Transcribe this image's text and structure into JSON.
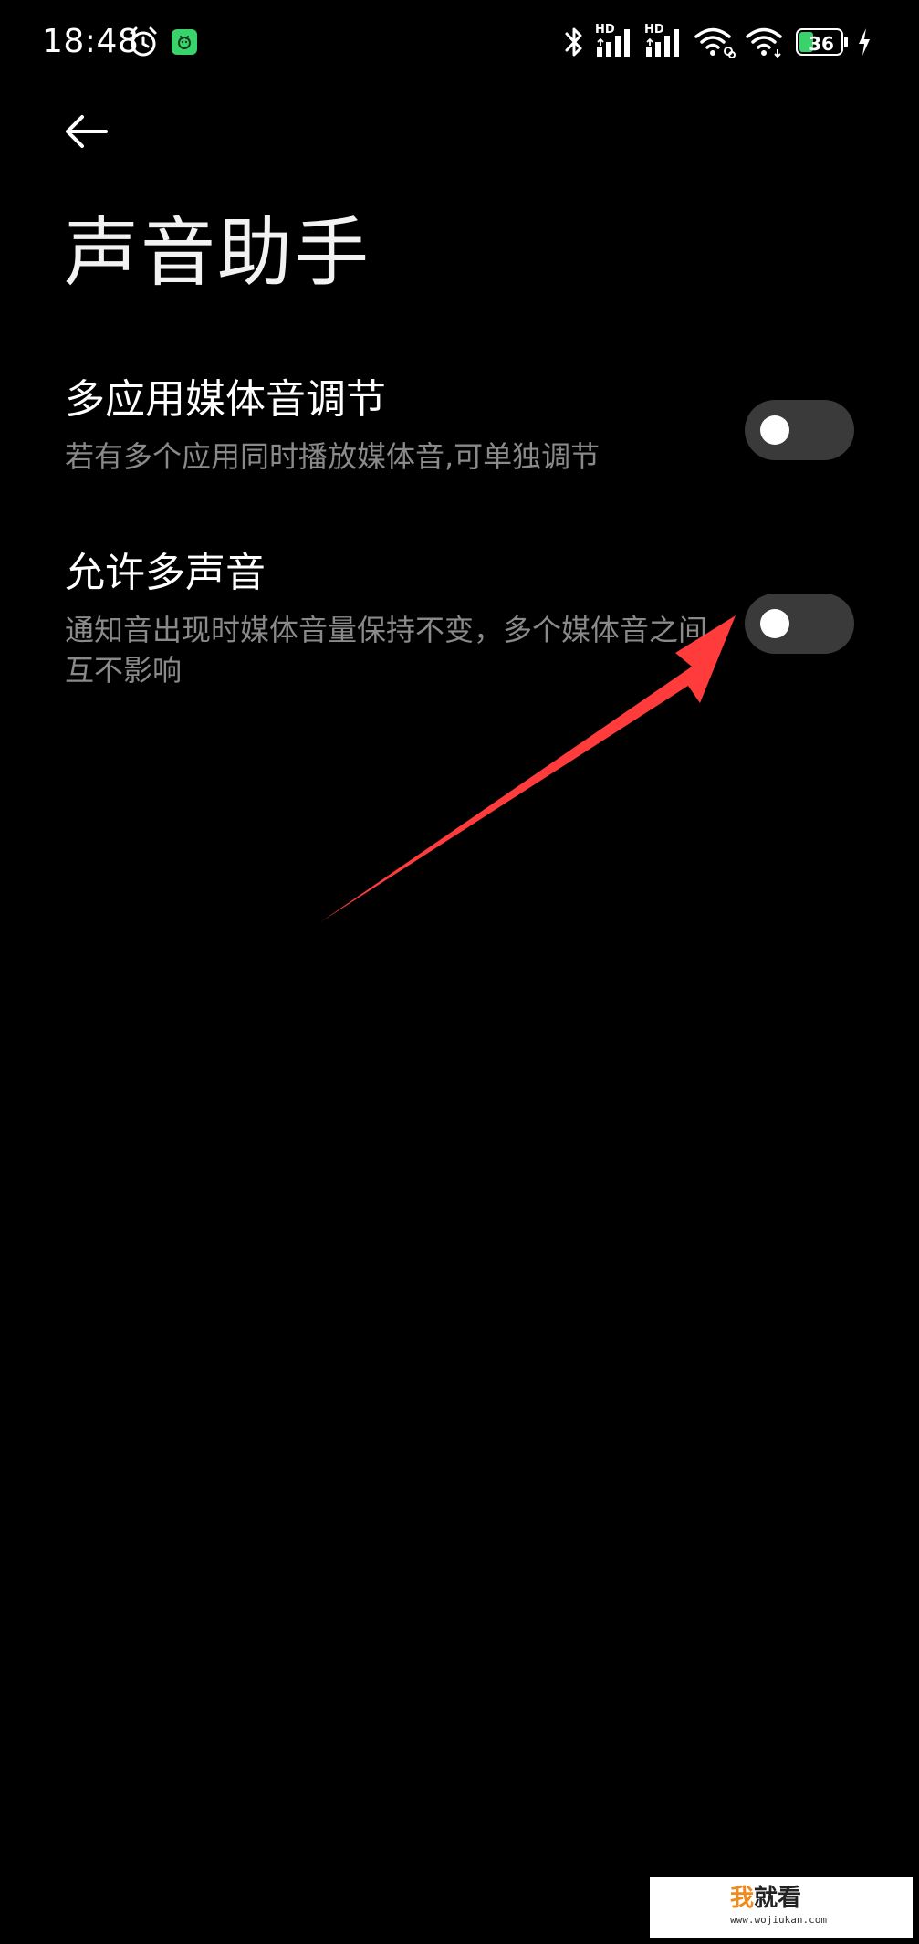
{
  "status_bar": {
    "time": "18:48",
    "battery_level": "36",
    "battery_fraction": 0.36,
    "network_label_1": "HD",
    "network_label_2": "HD",
    "icons": [
      "alarm-icon",
      "app-notification-icon",
      "bluetooth-icon",
      "signal-icon",
      "signal-icon",
      "wifi-icon",
      "wifi-icon",
      "battery-icon",
      "charging-icon"
    ]
  },
  "header": {
    "back_icon": "arrow-left-icon",
    "title": "声音助手"
  },
  "settings": [
    {
      "title": "多应用媒体音调节",
      "description": "若有多个应用同时播放媒体音,可单独调节",
      "enabled": false
    },
    {
      "title": "允许多声音",
      "description": "通知音出现时媒体音量保持不变，多个媒体音之间互不影响",
      "enabled": false
    }
  ],
  "annotation": {
    "type": "arrow",
    "color": "#ff3b3b"
  },
  "watermark": {
    "logo_char_1": "我",
    "logo_chars_2": "就看",
    "url": "www.wojiukan.com"
  },
  "colors": {
    "background": "#000000",
    "toggle_off_track": "#3a3a3a",
    "secondary_text": "#8a8a8a",
    "battery_green": "#3ad26a"
  }
}
